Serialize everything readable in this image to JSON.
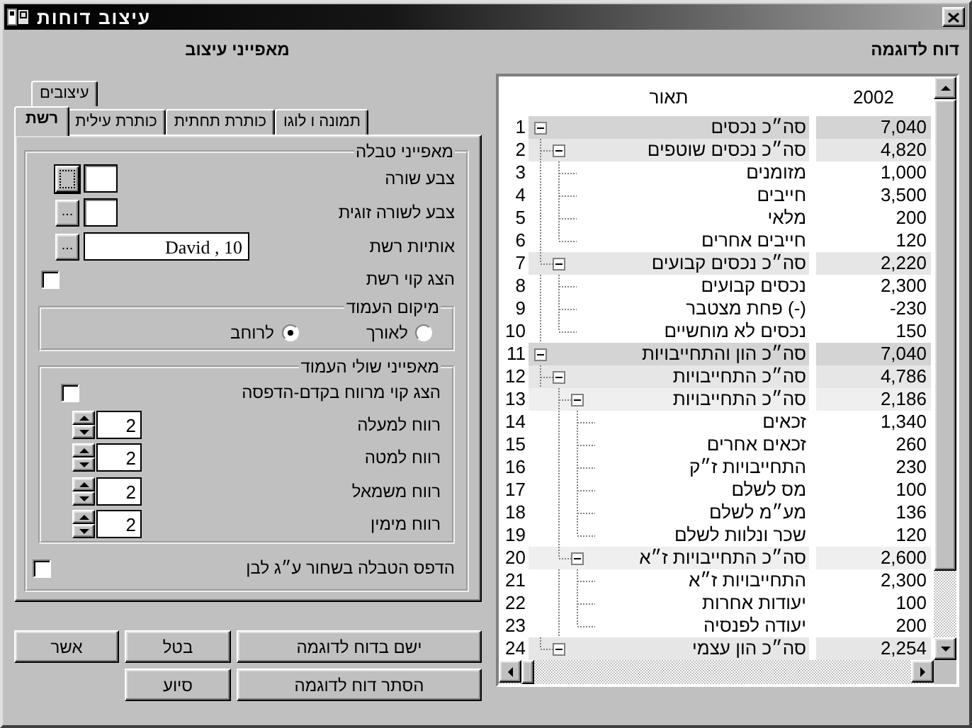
{
  "window": {
    "title": "עיצוב דוחות"
  },
  "settings": {
    "title": "מאפייני עיצוב",
    "back_tabs": [
      {
        "label": "עיצובים",
        "selected": false
      }
    ],
    "tabs": [
      {
        "label": "תמונה ו לוגו",
        "selected": false
      },
      {
        "label": "כותרת תחתית",
        "selected": false
      },
      {
        "label": "כותרת עילית",
        "selected": false
      },
      {
        "label": "רשת",
        "selected": true
      }
    ],
    "table_group": {
      "title": "מאפייני טבלה",
      "fields": [
        {
          "label": "צבע שורה",
          "kind": "color",
          "focused": true
        },
        {
          "label": "צבע לשורה זוגית",
          "kind": "color",
          "button": "...",
          "focused": false
        },
        {
          "label": "אותיות רשת",
          "kind": "font",
          "button": "...",
          "value": "David , 10",
          "focused": false
        }
      ],
      "grid_lines": {
        "label": "הצג קוי רשת",
        "checked": false
      },
      "orientation": {
        "title": "מיקום העמוד",
        "options": [
          {
            "label": "לאורך",
            "selected": false
          },
          {
            "label": "לרוחב",
            "selected": true
          }
        ]
      },
      "margins": {
        "title": "מאפייני שולי העמוד",
        "preview_lines": {
          "label": "הצג קוי מרווח בקדם-הדפסה",
          "checked": false
        },
        "spinners": [
          {
            "label": "רווח למעלה",
            "value": "2"
          },
          {
            "label": "רווח למטה",
            "value": "2"
          },
          {
            "label": "רווח משמאל",
            "value": "2"
          },
          {
            "label": "רווח מימין",
            "value": "2"
          }
        ]
      },
      "black_white": {
        "label": "הדפס הטבלה בשחור ע״ג לבן",
        "checked": false
      }
    },
    "buttons": [
      [
        "ישם בדוח לדוגמה",
        "בטל",
        "אשר"
      ],
      [
        "הסתר דוח לדוגמה",
        "סיוע"
      ]
    ]
  },
  "preview": {
    "title": "דוח לדוגמה",
    "column_headers": {
      "value": "2002",
      "description": "תאור"
    },
    "rows": [
      {
        "number": "1",
        "label": "סה״כ נכסים",
        "value": "7,040",
        "expanded": true,
        "children": [
          {
            "number": "2",
            "label": "סה״כ נכסים שוטפים",
            "value": "4,820",
            "expanded": true,
            "children": [
              {
                "number": "3",
                "label": "מזומנים",
                "value": "1,000"
              },
              {
                "number": "4",
                "label": "חייבים",
                "value": "3,500"
              },
              {
                "number": "5",
                "label": "מלאי",
                "value": "200"
              },
              {
                "number": "6",
                "label": "חייבים אחרים",
                "value": "120"
              }
            ]
          },
          {
            "number": "7",
            "label": "סה״כ נכסים קבועים",
            "value": "2,220",
            "expanded": true,
            "children": [
              {
                "number": "8",
                "label": "נכסים קבועים",
                "value": "2,300"
              },
              {
                "number": "9",
                "label": "(-) פחת מצטבר",
                "value": "-230"
              },
              {
                "number": "10",
                "label": "נכסים לא מוחשיים",
                "value": "150"
              }
            ]
          }
        ]
      },
      {
        "number": "11",
        "label": "סה״כ הון והתחייבויות",
        "value": "7,040",
        "expanded": true,
        "children": [
          {
            "number": "12",
            "label": "סה״כ התחייבויות",
            "value": "4,786",
            "expanded": true,
            "children": [
              {
                "number": "13",
                "label": "סה״כ התחייבויות",
                "value": "2,186",
                "expanded": true,
                "children": [
                  {
                    "number": "14",
                    "label": "זכאים",
                    "value": "1,340"
                  },
                  {
                    "number": "15",
                    "label": "זכאים אחרים",
                    "value": "260"
                  },
                  {
                    "number": "16",
                    "label": "התחייבויות ז״ק",
                    "value": "230"
                  },
                  {
                    "number": "17",
                    "label": "מס לשלם",
                    "value": "100"
                  },
                  {
                    "number": "18",
                    "label": "מע״מ לשלם",
                    "value": "136"
                  },
                  {
                    "number": "19",
                    "label": "שכר ונלוות לשלם",
                    "value": "120"
                  }
                ]
              },
              {
                "number": "20",
                "label": "סה״כ התחייבויות ז״א",
                "value": "2,600",
                "expanded": true,
                "children": [
                  {
                    "number": "21",
                    "label": "התחייבויות ז״א",
                    "value": "2,300"
                  },
                  {
                    "number": "22",
                    "label": "יעודות אחרות",
                    "value": "100"
                  },
                  {
                    "number": "23",
                    "label": "יעודה לפנסיה",
                    "value": "200"
                  }
                ]
              }
            ]
          },
          {
            "number": "24",
            "label": "סה״כ הון עצמי",
            "value": "2,254",
            "expanded": true
          }
        ]
      }
    ]
  }
}
